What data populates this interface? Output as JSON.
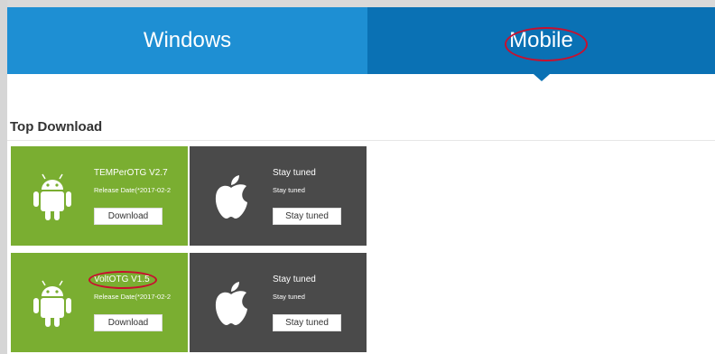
{
  "tabs": {
    "windows_label": "Windows",
    "mobile_label": "Mobile"
  },
  "section": {
    "title": "Top Download"
  },
  "cards": [
    {
      "platform": "android",
      "name": "TEMPerOTG V2.7",
      "sub": "Release Date(*2017-02-2",
      "button": "Download"
    },
    {
      "platform": "apple",
      "name": "Stay tuned",
      "sub": "Stay tuned",
      "button": "Stay tuned"
    },
    {
      "platform": "android",
      "name": "VoltOTG V1.5",
      "sub": "Release Date(*2017-02-2",
      "button": "Download"
    },
    {
      "platform": "apple",
      "name": "Stay tuned",
      "sub": "Stay tuned",
      "button": "Stay tuned"
    }
  ],
  "colors": {
    "windows_tab": "#1e8fd3",
    "mobile_tab": "#0a71b4",
    "android_card": "#7aae31",
    "apple_card": "#4a4a4a",
    "highlight_ring": "#c8102e"
  },
  "icons": [
    "android-icon",
    "apple-icon"
  ]
}
